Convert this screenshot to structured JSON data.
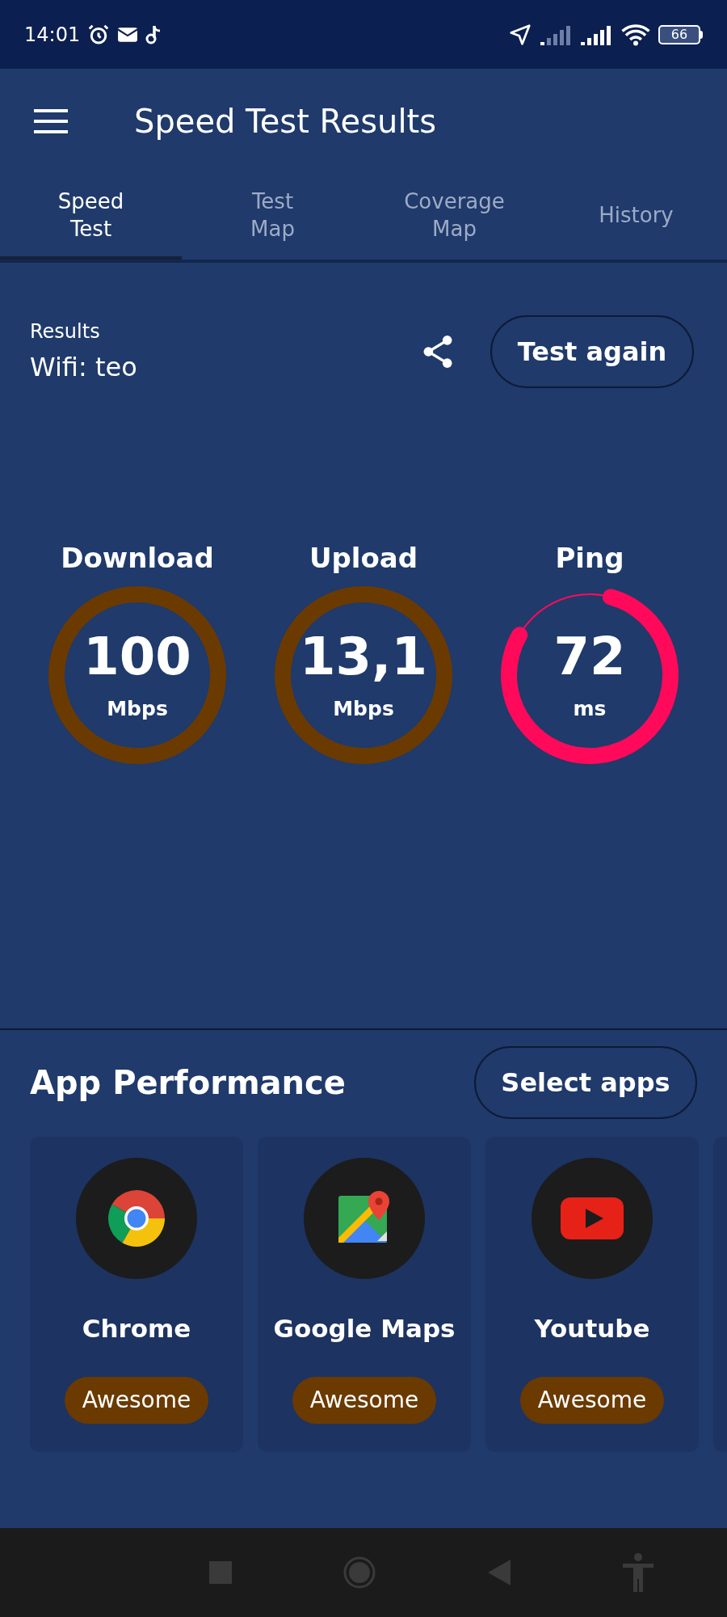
{
  "status_bar": {
    "time": "14:01",
    "battery": "66"
  },
  "app_bar": {
    "title": "Speed Test Results"
  },
  "tabs": [
    {
      "label": "Speed\nTest",
      "selected": true
    },
    {
      "label": "Test\nMap",
      "selected": false
    },
    {
      "label": "Coverage\nMap",
      "selected": false
    },
    {
      "label": "History",
      "selected": false
    }
  ],
  "results": {
    "heading": "Results",
    "network": "Wifi: teo",
    "button": "Test again"
  },
  "gauges": [
    {
      "label": "Download",
      "value": "100",
      "unit": "Mbps",
      "kind": "ring",
      "color": "#6b3a00"
    },
    {
      "label": "Upload",
      "value": "13,1",
      "unit": "Mbps",
      "kind": "ring",
      "color": "#6b3a00"
    },
    {
      "label": "Ping",
      "value": "72",
      "unit": "ms",
      "kind": "arc",
      "color": "#ff0a5a"
    }
  ],
  "app_performance": {
    "title": "App Performance",
    "button": "Select apps",
    "apps": [
      {
        "name": "Chrome",
        "kind": "chrome",
        "rating": "Awesome"
      },
      {
        "name": "Google Maps",
        "kind": "maps",
        "rating": "Awesome"
      },
      {
        "name": "Youtube",
        "kind": "youtube",
        "rating": "Awesome"
      }
    ]
  }
}
